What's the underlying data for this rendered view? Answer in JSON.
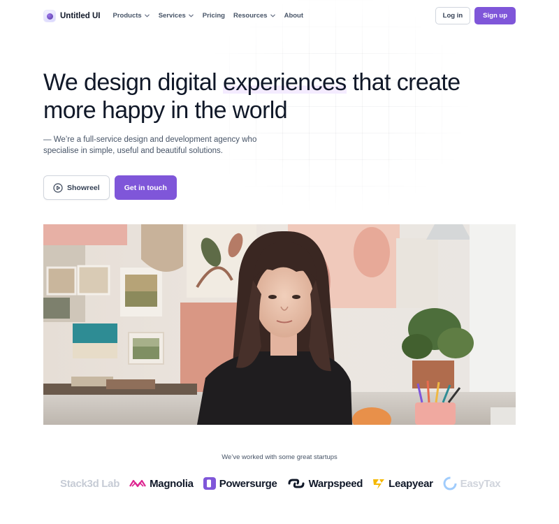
{
  "nav": {
    "brand": "Untitled UI",
    "links": [
      {
        "label": "Products",
        "dropdown": true
      },
      {
        "label": "Services",
        "dropdown": true
      },
      {
        "label": "Pricing",
        "dropdown": false
      },
      {
        "label": "Resources",
        "dropdown": true
      },
      {
        "label": "About",
        "dropdown": false
      }
    ],
    "login": "Log in",
    "signup": "Sign up"
  },
  "hero": {
    "title_part1": "We design digital ",
    "title_highlight": "experiences",
    "title_part2": " that create more happy in the world",
    "subtitle": "— We’re a full-service design and development agency who specialise in simple, useful and beautiful solutions.",
    "showreel": "Showreel",
    "cta": "Get in touch"
  },
  "logos": {
    "caption": "We’ve worked with some great startups",
    "items": [
      "Stack3d Lab",
      "Magnolia",
      "Powersurge",
      "Warpspeed",
      "Leapyear",
      "EasyTax"
    ]
  },
  "colors": {
    "accent": "#7f56d9",
    "text": "#101828",
    "muted": "#475467"
  }
}
